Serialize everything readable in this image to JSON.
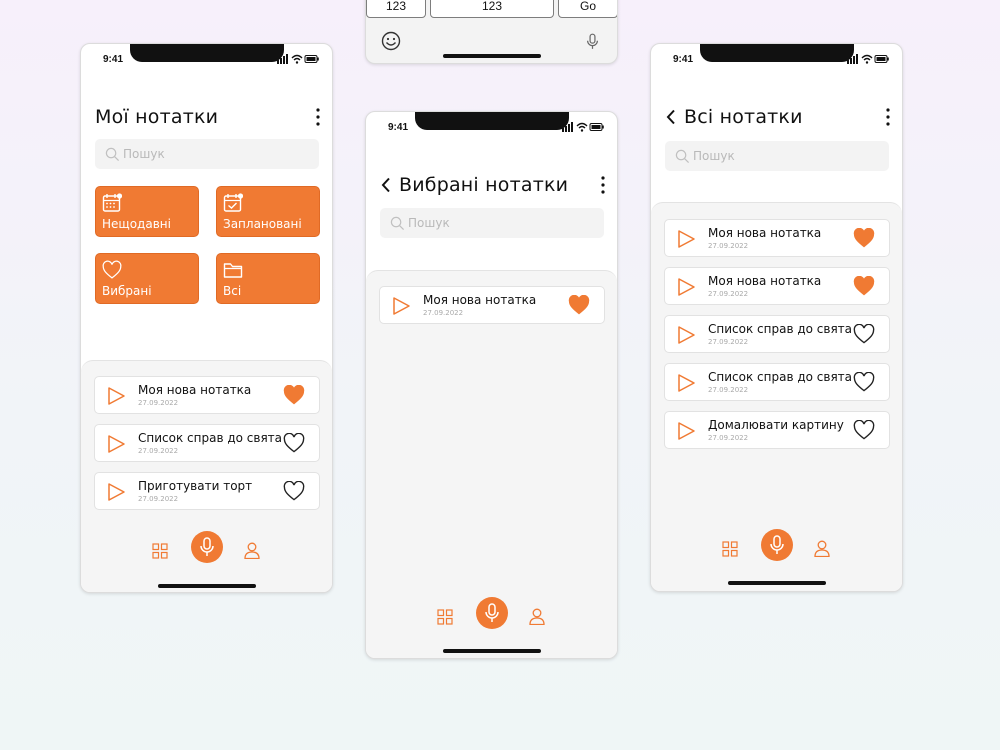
{
  "status": {
    "time": "9:41"
  },
  "keyboard": {
    "key_left": "123",
    "key_mid": "123",
    "key_go": "Go"
  },
  "screen1": {
    "title": "Мої нотатки",
    "search_placeholder": "Пошук",
    "categories": [
      {
        "label": "Нещодавні",
        "icon": "calendar-icon"
      },
      {
        "label": "Заплановані",
        "icon": "calendar-check-icon"
      },
      {
        "label": "Вибрані",
        "icon": "heart-icon"
      },
      {
        "label": "Всі",
        "icon": "folder-icon"
      }
    ],
    "notes": [
      {
        "title": "Моя нова нотатка",
        "date": "27.09.2022",
        "favorite": true
      },
      {
        "title": "Список справ до свята",
        "date": "27.09.2022",
        "favorite": false
      },
      {
        "title": "Приготувати торт",
        "date": "27.09.2022",
        "favorite": false
      }
    ]
  },
  "screen2": {
    "title": "Вибрані нотатки",
    "search_placeholder": "Пошук",
    "notes": [
      {
        "title": "Моя нова нотатка",
        "date": "27.09.2022",
        "favorite": true
      }
    ]
  },
  "screen3": {
    "title": "Всі нотатки",
    "search_placeholder": "Пошук",
    "notes": [
      {
        "title": "Моя нова нотатка",
        "date": "27.09.2022",
        "favorite": true
      },
      {
        "title": "Моя нова нотатка",
        "date": "27.09.2022",
        "favorite": true
      },
      {
        "title": "Список справ до свята",
        "date": "27.09.2022",
        "favorite": false
      },
      {
        "title": "Список справ до свята",
        "date": "27.09.2022",
        "favorite": false
      },
      {
        "title": "Домалювати картину",
        "date": "27.09.2022",
        "favorite": false
      }
    ]
  },
  "colors": {
    "accent": "#f07a33",
    "panel": "#f5f5f5",
    "search": "#f3f3f3"
  }
}
